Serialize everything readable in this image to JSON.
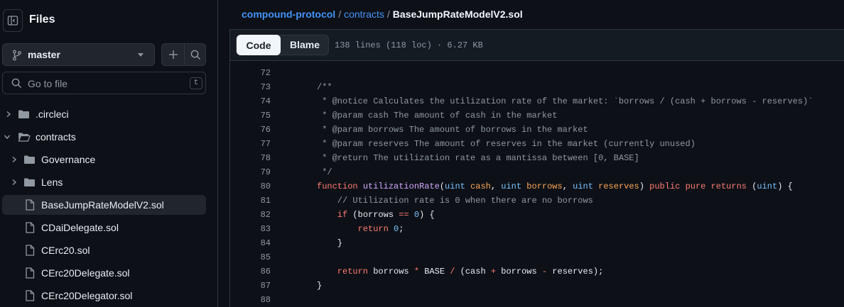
{
  "sidebar": {
    "title": "Files",
    "branch": "master",
    "goto_placeholder": "Go to file",
    "goto_shortcut": "t",
    "tree": [
      {
        "label": ".circleci",
        "type": "folder",
        "expanded": false,
        "depth": 0
      },
      {
        "label": "contracts",
        "type": "folder",
        "expanded": true,
        "depth": 0
      },
      {
        "label": "Governance",
        "type": "folder",
        "expanded": false,
        "depth": 1
      },
      {
        "label": "Lens",
        "type": "folder",
        "expanded": false,
        "depth": 1
      },
      {
        "label": "BaseJumpRateModelV2.sol",
        "type": "file",
        "active": true,
        "depth": 1
      },
      {
        "label": "CDaiDelegate.sol",
        "type": "file",
        "depth": 1
      },
      {
        "label": "CErc20.sol",
        "type": "file",
        "depth": 1
      },
      {
        "label": "CErc20Delegate.sol",
        "type": "file",
        "depth": 1
      },
      {
        "label": "CErc20Delegator.sol",
        "type": "file",
        "depth": 1
      }
    ]
  },
  "breadcrumb": {
    "repo": "compound-protocol",
    "folder": "contracts",
    "file": "BaseJumpRateModelV2.sol"
  },
  "file_header": {
    "code_tab": "Code",
    "blame_tab": "Blame",
    "meta": "138 lines (118 loc) · 6.27 KB"
  },
  "code": [
    {
      "n": "72",
      "tokens": []
    },
    {
      "n": "73",
      "tokens": [
        [
          "com",
          "/**"
        ]
      ]
    },
    {
      "n": "74",
      "tokens": [
        [
          "com",
          " * @notice Calculates the utilization rate of the market: `borrows / (cash + borrows - reserves)`"
        ]
      ]
    },
    {
      "n": "75",
      "tokens": [
        [
          "com",
          " * @param cash The amount of cash in the market"
        ]
      ]
    },
    {
      "n": "76",
      "tokens": [
        [
          "com",
          " * @param borrows The amount of borrows in the market"
        ]
      ]
    },
    {
      "n": "77",
      "tokens": [
        [
          "com",
          " * @param reserves The amount of reserves in the market (currently unused)"
        ]
      ]
    },
    {
      "n": "78",
      "tokens": [
        [
          "com",
          " * @return The utilization rate as a mantissa between [0, BASE]"
        ]
      ]
    },
    {
      "n": "79",
      "tokens": [
        [
          "com",
          " */"
        ]
      ]
    },
    {
      "n": "80",
      "tokens": [
        [
          "kw",
          "function "
        ],
        [
          "fn",
          "utilizationRate"
        ],
        [
          "pl",
          "("
        ],
        [
          "ty",
          "uint "
        ],
        [
          "var",
          "cash"
        ],
        [
          "pl",
          ", "
        ],
        [
          "ty",
          "uint "
        ],
        [
          "var",
          "borrows"
        ],
        [
          "pl",
          ", "
        ],
        [
          "ty",
          "uint "
        ],
        [
          "var",
          "reserves"
        ],
        [
          "pl",
          ") "
        ],
        [
          "kw",
          "public pure returns "
        ],
        [
          "pl",
          "("
        ],
        [
          "ty",
          "uint"
        ],
        [
          "pl",
          ") {"
        ]
      ]
    },
    {
      "n": "81",
      "tokens": [
        [
          "com",
          "    // Utilization rate is 0 when there are no borrows"
        ]
      ]
    },
    {
      "n": "82",
      "tokens": [
        [
          "kw",
          "    if "
        ],
        [
          "pl",
          "(borrows "
        ],
        [
          "op",
          "=="
        ],
        [
          "pl",
          " "
        ],
        [
          "num",
          "0"
        ],
        [
          "pl",
          ") {"
        ]
      ]
    },
    {
      "n": "83",
      "tokens": [
        [
          "kw",
          "        return "
        ],
        [
          "num",
          "0"
        ],
        [
          "pl",
          ";"
        ]
      ]
    },
    {
      "n": "84",
      "tokens": [
        [
          "pl",
          "    }"
        ]
      ]
    },
    {
      "n": "85",
      "tokens": []
    },
    {
      "n": "86",
      "tokens": [
        [
          "kw",
          "    return "
        ],
        [
          "pl",
          "borrows "
        ],
        [
          "op",
          "*"
        ],
        [
          "pl",
          " BASE "
        ],
        [
          "op",
          "/"
        ],
        [
          "pl",
          " (cash "
        ],
        [
          "op",
          "+"
        ],
        [
          "pl",
          " borrows "
        ],
        [
          "op",
          "-"
        ],
        [
          "pl",
          " reserves);"
        ]
      ]
    },
    {
      "n": "87",
      "tokens": [
        [
          "pl",
          "}"
        ]
      ]
    },
    {
      "n": "88",
      "tokens": []
    }
  ]
}
